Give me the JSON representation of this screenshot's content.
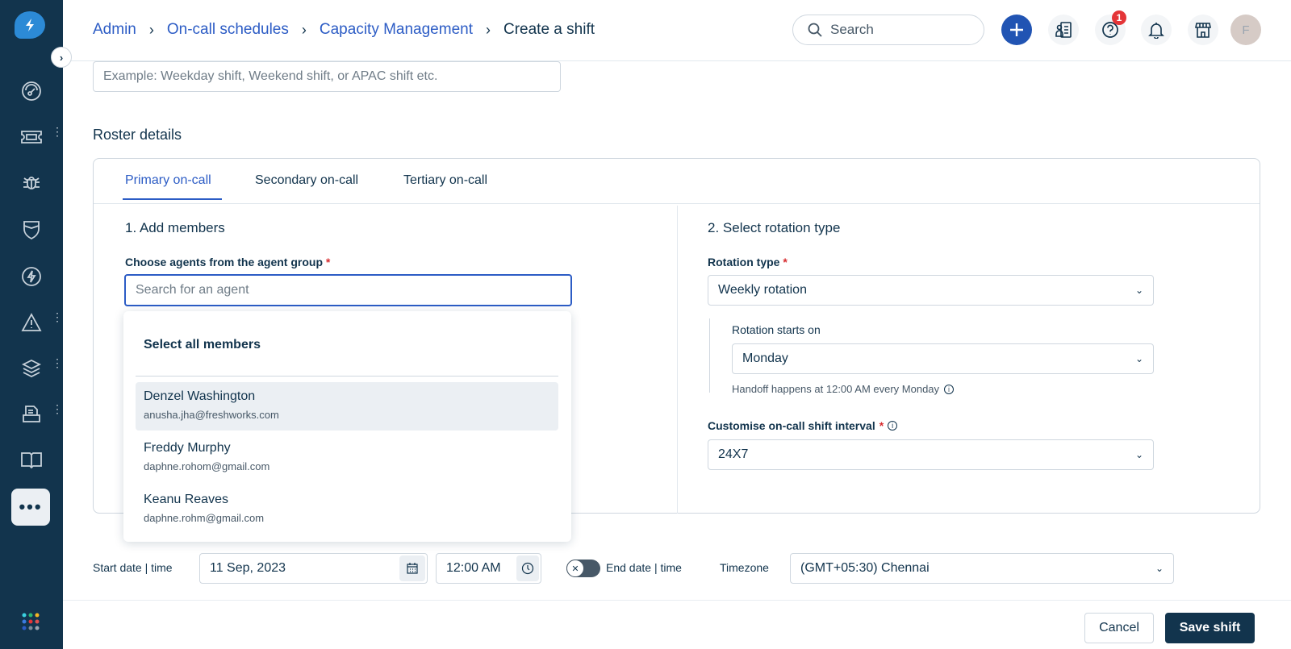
{
  "breadcrumb": [
    {
      "label": "Admin"
    },
    {
      "label": "On-call schedules"
    },
    {
      "label": "Capacity Management"
    }
  ],
  "page_title": "Create a shift",
  "header": {
    "search_placeholder": "Search",
    "help_badge": "1",
    "avatar_initial": "F",
    "colors": {
      "add_button": "#2154b3",
      "badge": "#e43538",
      "avatar": "#d6cbc6"
    }
  },
  "sidebar": {
    "items": [
      "dashboard-icon",
      "tickets-icon",
      "bug-icon",
      "shield-icon",
      "lightning-icon",
      "alert-icon",
      "layers-icon",
      "printer-icon",
      "book-icon"
    ],
    "more_label": "•••"
  },
  "form": {
    "name_placeholder": "Example: Weekday shift, Weekend shift, or APAC shift etc.",
    "roster_title": "Roster details",
    "tabs": [
      {
        "label": "Primary on-call",
        "active": true
      },
      {
        "label": "Secondary on-call"
      },
      {
        "label": "Tertiary on-call"
      }
    ],
    "add_members": {
      "title": "1. Add members",
      "label": "Choose agents from the agent group",
      "required": "*",
      "search_placeholder": "Search for an agent",
      "select_all": "Select all members",
      "agents": [
        {
          "name": "Denzel Washington",
          "email": "anusha.jha@freshworks.com",
          "highlighted": true
        },
        {
          "name": "Freddy Murphy",
          "email": "daphne.rohom@gmail.com"
        },
        {
          "name": "Keanu Reaves",
          "email": "daphne.rohm@gmail.com"
        }
      ]
    },
    "rotation": {
      "title": "2. Select rotation type",
      "type_label": "Rotation type",
      "type_value": "Weekly rotation",
      "starts_label": "Rotation starts on",
      "starts_value": "Monday",
      "handoff_hint": "Handoff happens at 12:00 AM every Monday",
      "interval_label": "Customise on-call shift interval",
      "interval_value": "24X7"
    },
    "start_label": "Start date | time",
    "start_date": "11 Sep, 2023",
    "start_time": "12:00 AM",
    "end_label": "End date | time",
    "end_enabled": false,
    "timezone_label": "Timezone",
    "timezone_value": "(GMT+05:30) Chennai"
  },
  "footer": {
    "cancel": "Cancel",
    "save": "Save shift"
  }
}
